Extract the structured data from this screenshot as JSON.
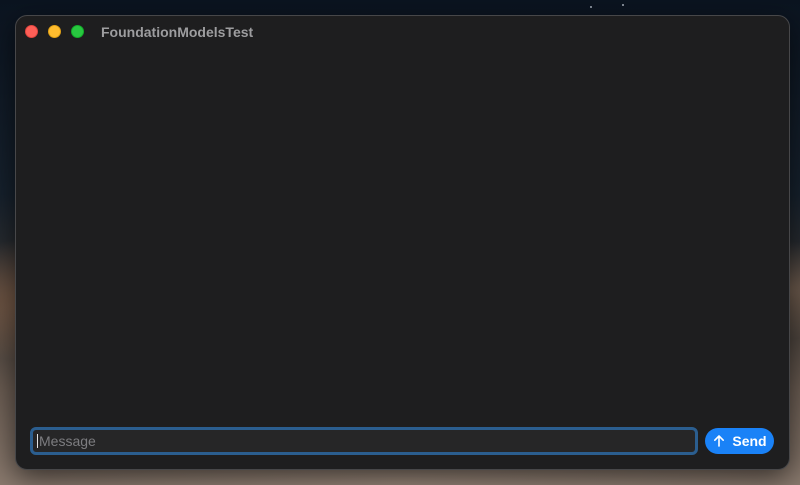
{
  "window": {
    "title": "FoundationModelsTest"
  },
  "traffic_lights": {
    "close_color": "#fe5f57",
    "minimize_color": "#febc2e",
    "maximize_color": "#28c840"
  },
  "composer": {
    "message_value": "",
    "message_placeholder": "Message",
    "send_label": "Send",
    "send_icon": "arrow-up-icon",
    "accent_color": "#1a82f7",
    "focus_ring_color": "#2b5e8f"
  }
}
